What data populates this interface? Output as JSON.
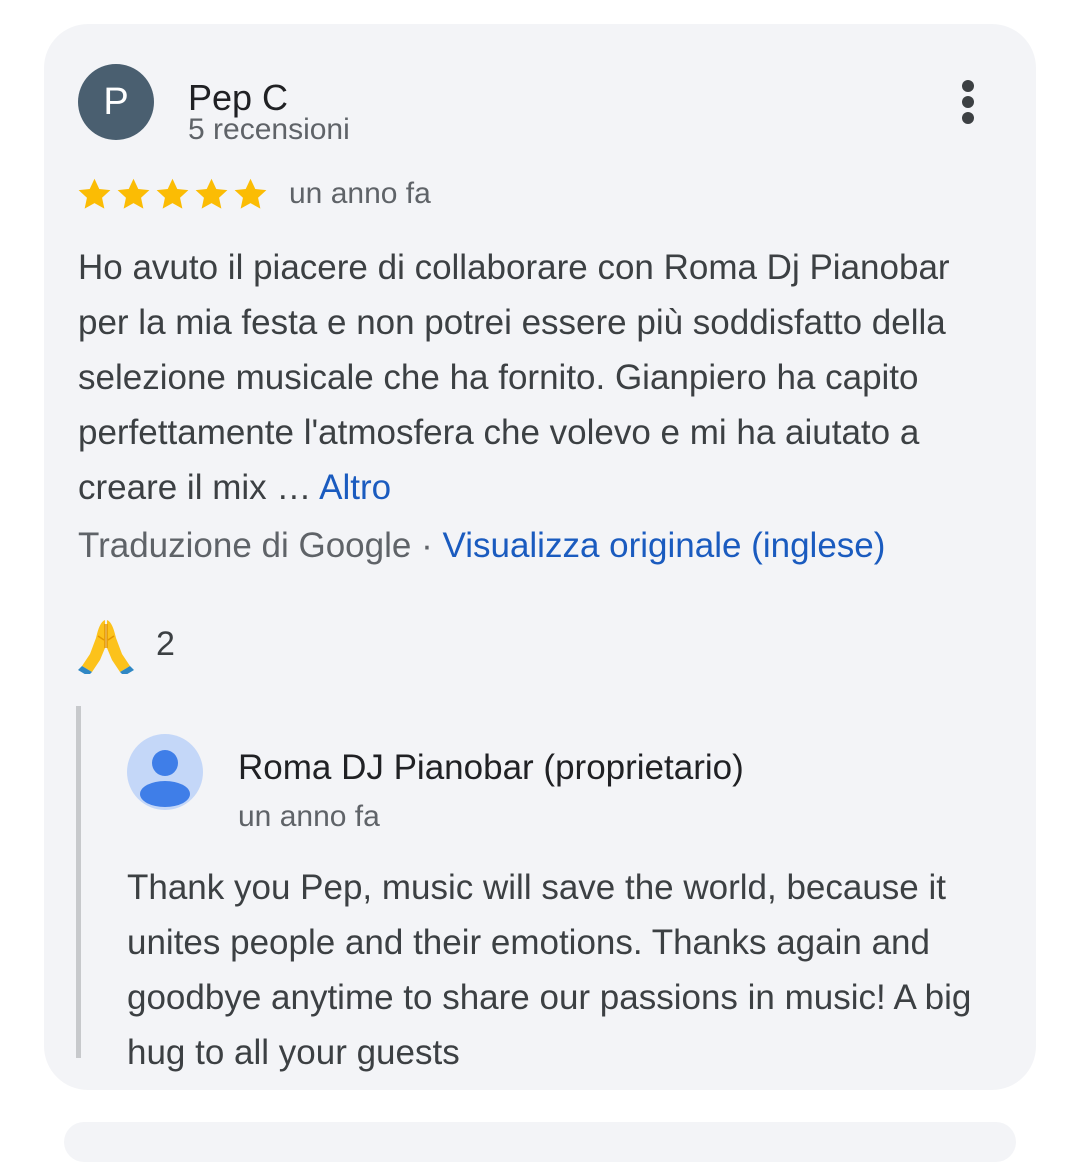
{
  "review": {
    "author": {
      "initial": "P",
      "name": "Pep C",
      "reviews_count": "5 recensioni"
    },
    "menu_icon": "more-vert-icon",
    "rating": 5,
    "rating_max": 5,
    "star_color": "#fbbc04",
    "time": "un anno fa",
    "text": "Ho avuto il piacere di collaborare con Roma Dj Pianobar per la mia festa e non potrei essere più soddisfatto della selezione musicale che ha fornito. Gianpiero ha capito perfettamente l'atmosfera che volevo e mi ha aiutato a creare il mix …",
    "more_label": "Altro",
    "translation_label": "Traduzione di Google",
    "translation_separator": "·",
    "view_original_label": "Visualizza originale (inglese)",
    "reaction": {
      "icon": "folded-hands-emoji",
      "count": "2"
    }
  },
  "owner_response": {
    "avatar_icon": "person-icon",
    "name": "Roma DJ Pianobar (proprietario)",
    "time": "un anno fa",
    "text": "Thank you Pep, music will save the world, because it unites people and their emotions. Thanks again and goodbye anytime to share our passions in music! A big hug to all your guests"
  },
  "colors": {
    "link": "#1a5bbf",
    "card_background": "#f3f4f7",
    "avatar_background": "#4a5f70"
  }
}
